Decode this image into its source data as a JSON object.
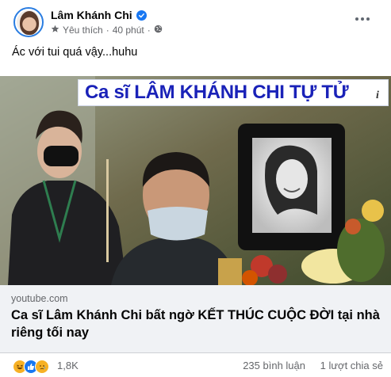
{
  "post": {
    "author": "Lâm Khánh Chi",
    "audience": "Yêu thích",
    "separator": "·",
    "time": "40 phút",
    "separator2": "·",
    "caption": "Ác với tui quá vậy...huhu"
  },
  "preview": {
    "headline": "Ca sĩ LÂM KHÁNH CHI TỰ TỬ",
    "info_glyph": "i"
  },
  "link": {
    "domain": "youtube.com",
    "title": "Ca sĩ Lâm Khánh Chi bất ngờ KẾT THÚC CUỘC ĐỜI tại nhà riêng tối nay"
  },
  "footer": {
    "reaction_count": "1,8K",
    "comments": "235 bình luận",
    "shares": "1 lượt chia sẻ"
  },
  "colors": {
    "verified": "#1877f2",
    "banner_text": "#1a22b8",
    "meta": "#65676b"
  },
  "icons": [
    "star-icon",
    "globe-icon",
    "verified-icon",
    "more-icon",
    "info-icon",
    "haha-icon",
    "like-icon",
    "sad-icon"
  ]
}
